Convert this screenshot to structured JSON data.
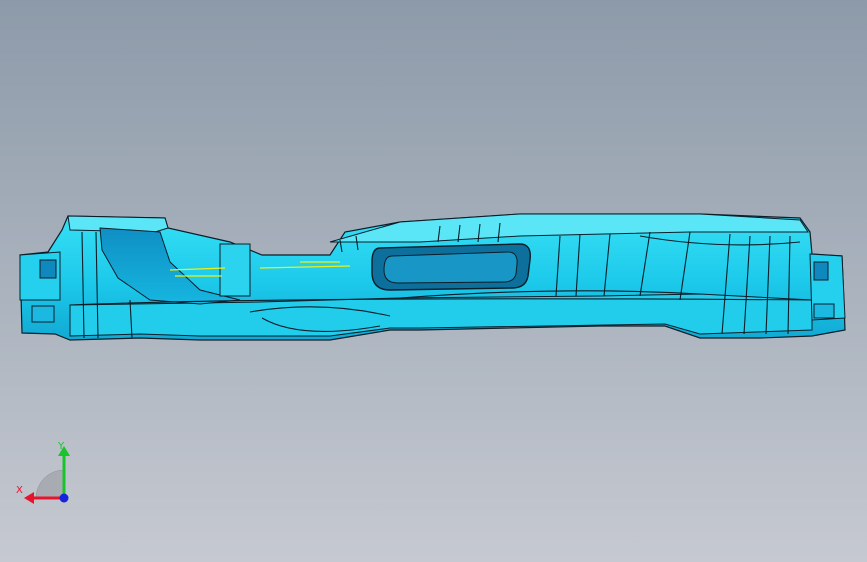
{
  "viewport": {
    "background_top": "#8d9aa9",
    "background_bottom": "#c6c9d1"
  },
  "model": {
    "fill_color": "#1fd3ef",
    "shade_color": "#11a9d3",
    "edge_color": "#0b1e2a",
    "highlight_color": "#e6f21c"
  },
  "triad": {
    "x_label": "X",
    "y_label": "Y",
    "x_color": "#e8132d",
    "y_color": "#17c52a",
    "z_color": "#1624d9"
  }
}
